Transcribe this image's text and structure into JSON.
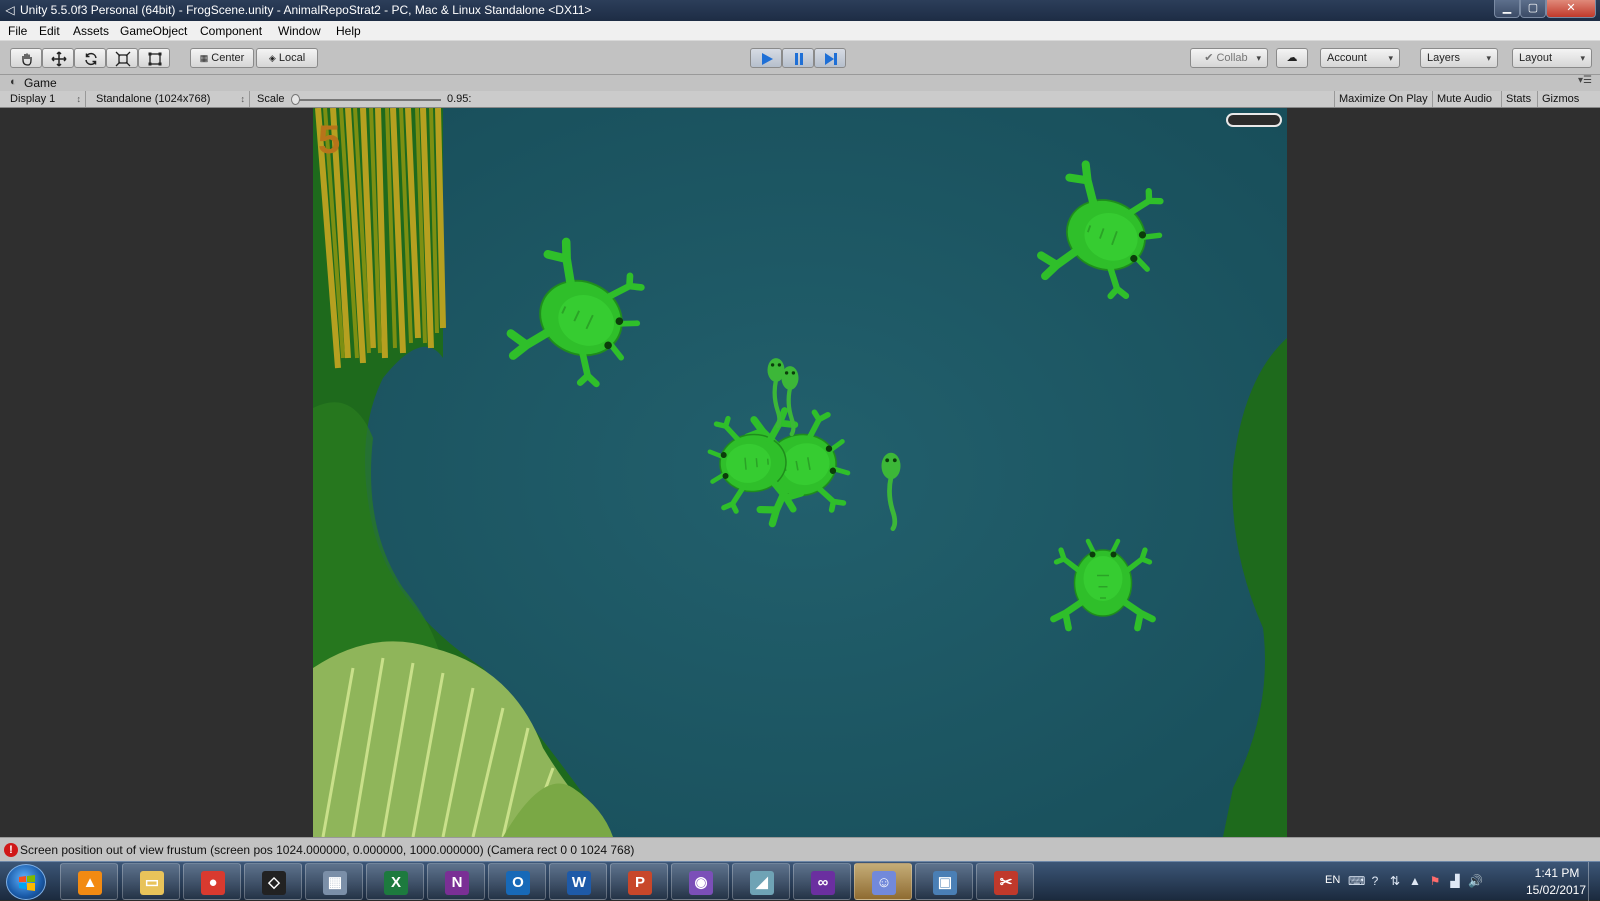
{
  "window": {
    "title": "Unity 5.5.0f3 Personal (64bit) - FrogScene.unity - AnimalRepoStrat2 - PC, Mac & Linux Standalone <DX11>",
    "minimize_icon": "minimize-icon",
    "maximize_icon": "maximize-icon",
    "close_icon": "close-icon"
  },
  "menu": [
    "File",
    "Edit",
    "Assets",
    "GameObject",
    "Component",
    "Window",
    "Help"
  ],
  "toolbar": {
    "tools": [
      "hand-tool-icon",
      "move-tool-icon",
      "rotate-tool-icon",
      "scale-tool-icon",
      "rect-tool-icon"
    ],
    "pivot_label": "Center",
    "space_label": "Local",
    "play_controls": [
      "play-icon",
      "pause-icon",
      "step-icon"
    ],
    "collab_label": "Collab",
    "account_label": "Account",
    "layers_label": "Layers",
    "layout_label": "Layout",
    "play_color": "#1e6fd6"
  },
  "game_tab": {
    "label": "Game"
  },
  "game_bar": {
    "display": "Display 1",
    "resolution": "Standalone (1024x768)",
    "scale_label": "Scale",
    "scale_value": "0.95:",
    "maximize_on_play": "Maximize On Play",
    "mute_audio": "Mute Audio",
    "stats": "Stats",
    "gizmos": "Gizmos"
  },
  "game": {
    "score": "5",
    "water_color": "#1d5a66",
    "frog_color": "#2fbf2a"
  },
  "status": {
    "message": "Screen position out of view frustum (screen pos 1024.000000, 0.000000, 1000.000000) (Camera rect 0 0 1024 768)"
  },
  "taskbar": {
    "apps": [
      {
        "name": "vlc-icon",
        "glyph": "▲",
        "color": "#f28a12"
      },
      {
        "name": "file-explorer-icon",
        "glyph": "▭",
        "color": "#e8c35a"
      },
      {
        "name": "chrome-icon",
        "glyph": "●",
        "color": "#d93a2f"
      },
      {
        "name": "unity-icon",
        "glyph": "◇",
        "color": "#222222"
      },
      {
        "name": "calculator-icon",
        "glyph": "▦",
        "color": "#7b8fa8"
      },
      {
        "name": "excel-icon",
        "glyph": "X",
        "color": "#1d7a3e"
      },
      {
        "name": "onenote-icon",
        "glyph": "N",
        "color": "#7a2f95"
      },
      {
        "name": "outlook-icon",
        "glyph": "O",
        "color": "#1769b8"
      },
      {
        "name": "word-icon",
        "glyph": "W",
        "color": "#1e5aa8"
      },
      {
        "name": "powerpoint-icon",
        "glyph": "P",
        "color": "#c8472a"
      },
      {
        "name": "github-desktop-icon",
        "glyph": "◉",
        "color": "#7b4fb8"
      },
      {
        "name": "notes-app-icon",
        "glyph": "◢",
        "color": "#6fa3b5"
      },
      {
        "name": "visual-studio-icon",
        "glyph": "∞",
        "color": "#6b2fa0"
      },
      {
        "name": "discord-icon",
        "glyph": "☺",
        "color": "#7289da"
      },
      {
        "name": "photo-viewer-icon",
        "glyph": "▣",
        "color": "#4a7fb5"
      },
      {
        "name": "snipping-tool-icon",
        "glyph": "✂",
        "color": "#c0392b"
      }
    ],
    "active_app": "discord-icon",
    "language": "EN",
    "time": "1:41 PM",
    "date": "15/02/2017"
  }
}
